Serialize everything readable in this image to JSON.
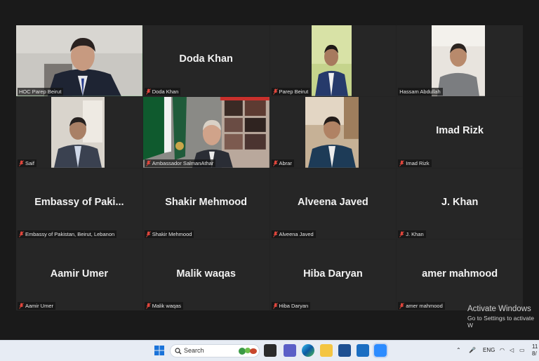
{
  "participants": [
    {
      "label": "HOC Parep Beirut",
      "big_name": "",
      "video": true,
      "active": true,
      "muted": false
    },
    {
      "label": "Doda Khan",
      "big_name": "Doda Khan",
      "video": false,
      "muted": true
    },
    {
      "label": "Parep Beirut",
      "big_name": "",
      "video": true,
      "muted": true
    },
    {
      "label": "Hassam Abdullah",
      "big_name": "",
      "video": true,
      "muted": false
    },
    {
      "label": "Saif",
      "big_name": "",
      "video": true,
      "muted": true
    },
    {
      "label": "Ambassador SalmanAthar",
      "big_name": "",
      "video": true,
      "muted": true
    },
    {
      "label": "Abrar",
      "big_name": "",
      "video": true,
      "muted": true
    },
    {
      "label": "Imad Rizk",
      "big_name": "Imad Rizk",
      "video": false,
      "muted": true
    },
    {
      "label": "Embassy of Pakistan, Beirut, Lebanon",
      "big_name": "Embassy of Paki...",
      "video": false,
      "muted": true
    },
    {
      "label": "Shakir Mehmood",
      "big_name": "Shakir Mehmood",
      "video": false,
      "muted": true
    },
    {
      "label": "Alveena Javed",
      "big_name": "Alveena Javed",
      "video": false,
      "muted": true
    },
    {
      "label": "J. Khan",
      "big_name": "J. Khan",
      "video": false,
      "muted": true
    },
    {
      "label": "Aamir Umer",
      "big_name": "Aamir Umer",
      "video": false,
      "muted": true
    },
    {
      "label": "Malik waqas",
      "big_name": "Malik waqas",
      "video": false,
      "muted": true
    },
    {
      "label": "Hiba Daryan",
      "big_name": "Hiba Daryan",
      "video": false,
      "muted": true
    },
    {
      "label": "amer mahmood",
      "big_name": "amer mahmood",
      "video": false,
      "muted": true
    }
  ],
  "watermark": {
    "title": "Activate Windows",
    "subtitle": "Go to Settings to activate W"
  },
  "taskbar": {
    "search_placeholder": "Search",
    "lang": "ENG",
    "clock_time": "11",
    "clock_date": "8/",
    "icons": [
      "windows-start-icon",
      "search-icon",
      "task-view-icon",
      "teams-icon",
      "edge-icon",
      "file-explorer-icon",
      "store-icon",
      "mail-icon",
      "zoom-icon"
    ]
  },
  "colors": {
    "active_border": "#5fd36a",
    "mute_red": "#e0463c",
    "tile_bg": "#262626"
  }
}
